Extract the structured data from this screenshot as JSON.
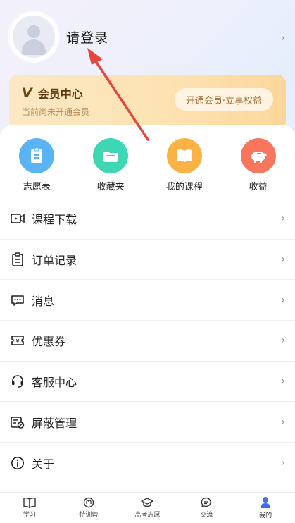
{
  "profile": {
    "login_label": "请登录"
  },
  "vip": {
    "title": "会员中心",
    "subtitle": "当前尚未开通会员",
    "button": "开通会员·立享权益"
  },
  "shortcuts": [
    {
      "label": "志愿表",
      "icon": "form-icon",
      "color": "#5ab3f5"
    },
    {
      "label": "收藏夹",
      "icon": "folder-icon",
      "color": "#3ed6b3"
    },
    {
      "label": "我的课程",
      "icon": "book-icon",
      "color": "#fbb244"
    },
    {
      "label": "收益",
      "icon": "piggy-bank-icon",
      "color": "#f8775c"
    }
  ],
  "menu": [
    {
      "label": "课程下载",
      "icon": "video-download-icon"
    },
    {
      "label": "订单记录",
      "icon": "clipboard-icon"
    },
    {
      "label": "消息",
      "icon": "message-icon"
    },
    {
      "label": "优惠券",
      "icon": "coupon-icon"
    },
    {
      "label": "客服中心",
      "icon": "headset-icon"
    },
    {
      "label": "屏蔽管理",
      "icon": "block-manage-icon"
    },
    {
      "label": "关于",
      "icon": "info-icon"
    }
  ],
  "tabs": [
    {
      "label": "学习",
      "icon": "book-open-icon"
    },
    {
      "label": "特训营",
      "icon": "camp-icon"
    },
    {
      "label": "高考志愿",
      "icon": "graduation-cap-icon"
    },
    {
      "label": "交流",
      "icon": "chat-icon"
    },
    {
      "label": "我的",
      "icon": "user-icon",
      "active": true
    }
  ],
  "colors": {
    "accent_red": "#e8453c",
    "vip_text": "#5b3a10",
    "active_tab": "#3a6df0"
  }
}
